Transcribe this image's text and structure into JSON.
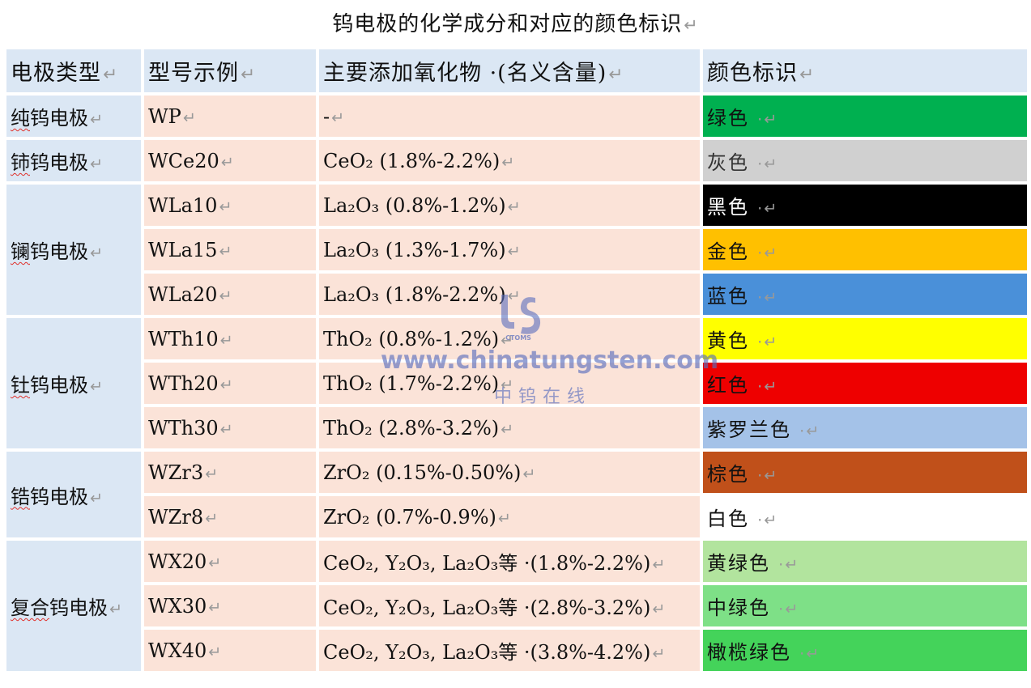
{
  "title": "钨电极的化学成分和对应的颜色标识",
  "para_mark": "↵",
  "headers": [
    "电极类型",
    "型号示例",
    "主要添加氧化物 ·(名义含量)",
    "颜色标识"
  ],
  "groups": [
    {
      "type": "纯钨电极",
      "rows": [
        {
          "model": "WP",
          "comp": "-",
          "color_name": "绿色",
          "bg": "#00b050",
          "fg": "#111111"
        }
      ]
    },
    {
      "type": "铈钨电极",
      "rows": [
        {
          "model": "WCe20",
          "comp": "CeO₂ (1.8%-2.2%)",
          "color_name": "灰色",
          "bg": "#d0d0d0",
          "fg": "#333333"
        }
      ]
    },
    {
      "type": "镧钨电极",
      "rows": [
        {
          "model": "WLa10",
          "comp": "La₂O₃ (0.8%-1.2%)",
          "color_name": "黑色",
          "bg": "#000000",
          "fg": "#ffffff"
        },
        {
          "model": "WLa15",
          "comp": "La₂O₃ (1.3%-1.7%)",
          "color_name": "金色",
          "bg": "#ffc000",
          "fg": "#111111"
        },
        {
          "model": "WLa20",
          "comp": "La₂O₃ (1.8%-2.2%)",
          "color_name": "蓝色",
          "bg": "#4a90d9",
          "fg": "#111111"
        }
      ]
    },
    {
      "type": "钍钨电极",
      "rows": [
        {
          "model": "WTh10",
          "comp": "ThO₂ (0.8%-1.2%)",
          "color_name": "黄色",
          "bg": "#ffff00",
          "fg": "#111111"
        },
        {
          "model": "WTh20",
          "comp": "ThO₂ (1.7%-2.2%)",
          "color_name": "红色",
          "bg": "#ee0000",
          "fg": "#111111"
        },
        {
          "model": "WTh30",
          "comp": "ThO₂ (2.8%-3.2%)",
          "color_name": "紫罗兰色",
          "bg": "#a4c2e8",
          "fg": "#111111"
        }
      ]
    },
    {
      "type": "锆钨电极",
      "rows": [
        {
          "model": "WZr3",
          "comp": "ZrO₂ (0.15%-0.50%)",
          "color_name": "棕色",
          "bg": "#c0501a",
          "fg": "#111111"
        },
        {
          "model": "WZr8",
          "comp": "ZrO₂ (0.7%-0.9%)",
          "color_name": "白色",
          "bg": "#ffffff",
          "fg": "#111111"
        }
      ]
    },
    {
      "type": "复合钨电极",
      "rows": [
        {
          "model": "WX20",
          "comp": "CeO₂, Y₂O₃, La₂O₃等 ·(1.8%-2.2%)",
          "color_name": "黄绿色",
          "bg": "#b2e49e",
          "fg": "#111111"
        },
        {
          "model": "WX30",
          "comp": "CeO₂, Y₂O₃, La₂O₃等 ·(2.8%-3.2%)",
          "color_name": "中绿色",
          "bg": "#7ee087",
          "fg": "#111111"
        },
        {
          "model": "WX40",
          "comp": "CeO₂, Y₂O₃, La₂O₃等 ·(3.8%-4.2%)",
          "color_name": "橄榄绿色",
          "bg": "#44d35a",
          "fg": "#111111"
        }
      ]
    }
  ],
  "watermark": {
    "logo_text": "CTOMS",
    "url": "www.chinatungsten.com",
    "cn": "中钨在线",
    "color": "#5a6ebe"
  }
}
